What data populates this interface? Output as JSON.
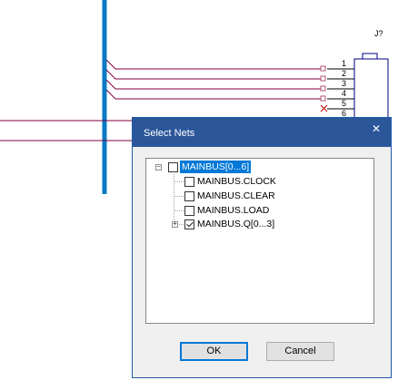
{
  "schematic": {
    "component_refdes": "J?",
    "pin_numbers": [
      "1",
      "2",
      "3",
      "4",
      "5",
      "6"
    ]
  },
  "dialog": {
    "title": "Select Nets",
    "close_glyph": "✕",
    "tree": {
      "root": {
        "label": "MAINBUS[0...6]",
        "checked": false,
        "expanded": true,
        "selected": true
      },
      "children": [
        {
          "label": "MAINBUS.CLOCK",
          "checked": false,
          "has_children": false
        },
        {
          "label": "MAINBUS.CLEAR",
          "checked": false,
          "has_children": false
        },
        {
          "label": "MAINBUS.LOAD",
          "checked": false,
          "has_children": false
        },
        {
          "label": "MAINBUS.Q[0...3]",
          "checked": true,
          "has_children": true
        }
      ]
    },
    "ok_label": "OK",
    "cancel_label": "Cancel"
  },
  "colors": {
    "bus": "#0a7ac4",
    "wire": "#800040",
    "title_bar": "#2b579a",
    "selection": "#0078d7"
  }
}
